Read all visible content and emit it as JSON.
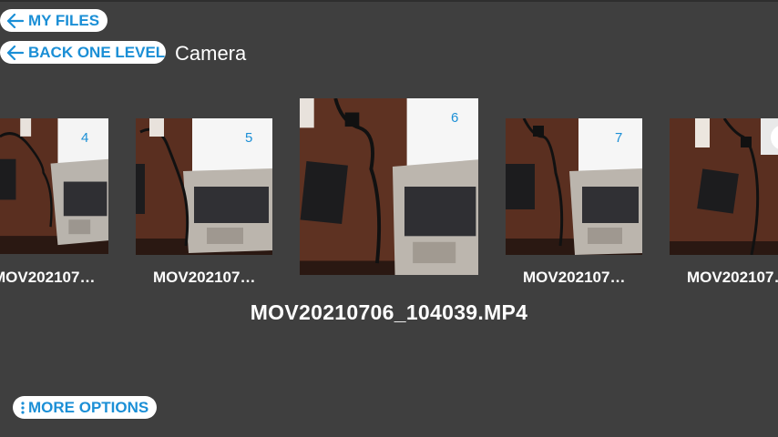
{
  "nav": {
    "my_files_label": "MY FILES",
    "back_label": "BACK ONE LEVEL",
    "folder_title": "Camera",
    "more_options_label": "MORE OPTIONS"
  },
  "carousel": {
    "items": [
      {
        "number": "4",
        "caption": "MOV202107…"
      },
      {
        "number": "5",
        "caption": "MOV202107…"
      },
      {
        "number": "6",
        "caption": ""
      },
      {
        "number": "7",
        "caption": "MOV202107…"
      },
      {
        "number": "",
        "caption": "MOV202107…"
      }
    ],
    "selected_caption": "MOV20210706_104039.MP4"
  },
  "colors": {
    "accent": "#1b8fd6",
    "background": "#3f3f3f",
    "pill": "#ffffff"
  },
  "icons": {
    "back": "arrow-left-icon",
    "more": "vertical-dots-icon"
  }
}
